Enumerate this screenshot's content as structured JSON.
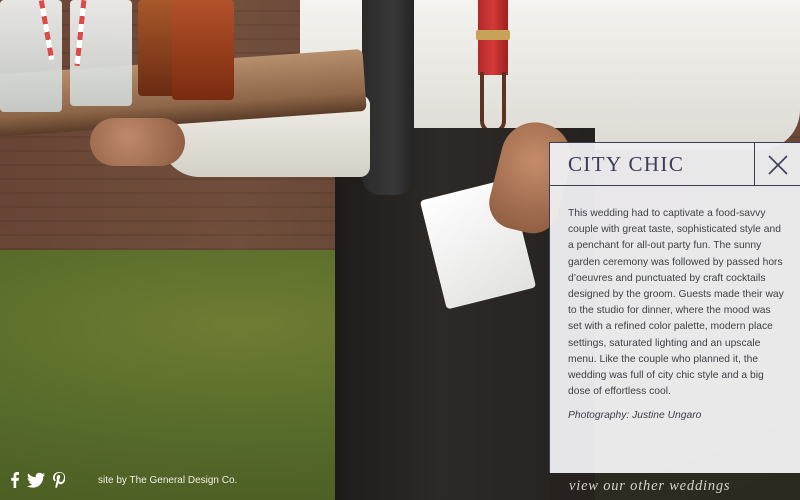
{
  "panel": {
    "title": "CITY CHIC",
    "description": "This wedding had to captivate a food-savvy couple with great taste, sophisticated style and a penchant for all-out party fun. The sunny garden ceremony was followed by passed hors d’oeuvres and punctuated by craft cocktails designed by the groom. Guests made their way to the studio for dinner, where the mood was set with a refined color palette, modern place settings, saturated lighting and an upscale menu.  Like the couple who planned it, the wedding was full of city chic style and a big dose of effortless cool.",
    "photo_credit": "Photography: Justine Ungaro",
    "close_icon": "close-icon"
  },
  "footer": {
    "other_weddings_link": "view our other weddings",
    "site_credit": "site by The General Design Co.",
    "social_icons": [
      "facebook-icon",
      "twitter-icon",
      "pinterest-icon"
    ]
  },
  "colors": {
    "panel_bg": "#eeeef0",
    "accent_navy": "#3b3e56",
    "bottom_bar": "#28221e"
  }
}
